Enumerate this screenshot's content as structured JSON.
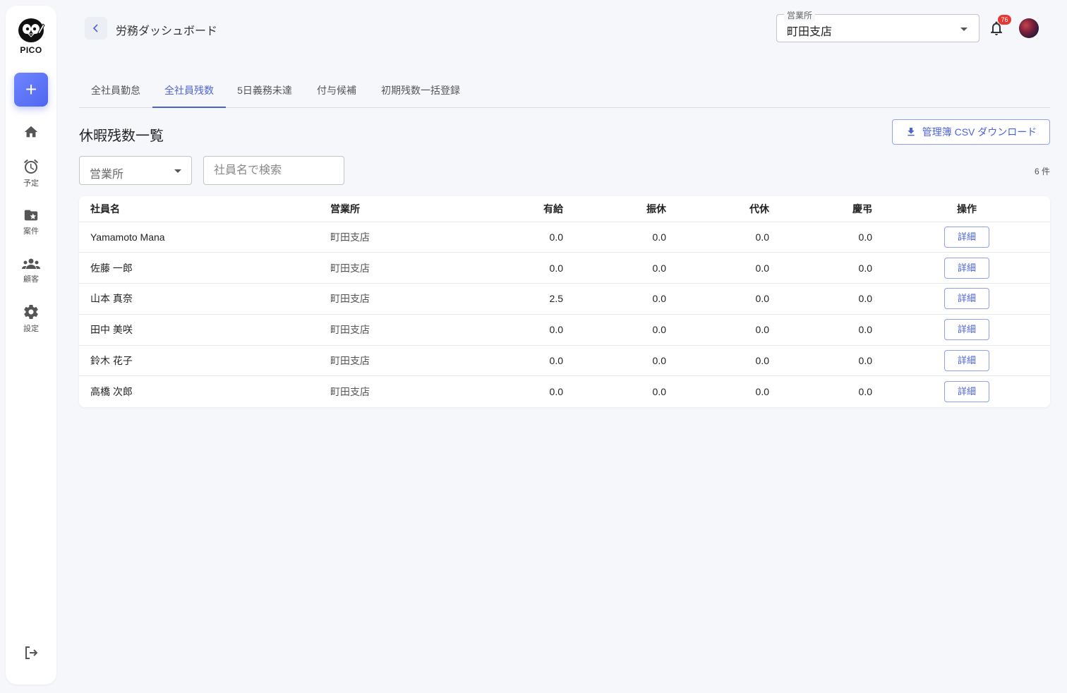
{
  "app": {
    "logo_text": "PICO",
    "accent_color": "#4c63d8"
  },
  "sidebar": {
    "add_button_label": "+",
    "items": [
      {
        "name": "home",
        "icon": "home-icon",
        "label": ""
      },
      {
        "name": "schedule",
        "icon": "alarm-clock-icon",
        "label": "予定"
      },
      {
        "name": "cases",
        "icon": "folder-star-icon",
        "label": "案件"
      },
      {
        "name": "customers",
        "icon": "people-icon",
        "label": "顧客"
      },
      {
        "name": "settings",
        "icon": "gear-icon",
        "label": "設定"
      }
    ],
    "logout_icon": "logout-icon"
  },
  "header": {
    "title": "労務ダッシュボード",
    "office_select": {
      "legend": "営業所",
      "value": "町田支店"
    },
    "notification_count": "76"
  },
  "tabs": [
    {
      "label": "全社員勤怠",
      "active": false
    },
    {
      "label": "全社員残数",
      "active": true
    },
    {
      "label": "5日義務未達",
      "active": false
    },
    {
      "label": "付与候補",
      "active": false
    },
    {
      "label": "初期残数一括登録",
      "active": false
    }
  ],
  "section": {
    "title": "休暇残数一覧",
    "csv_button_label": "管理簿 CSV ダウンロード",
    "filter_office_placeholder": "営業所",
    "search_placeholder": "社員名で検索",
    "count_text": "6 件"
  },
  "table": {
    "headers": {
      "name": "社員名",
      "office": "営業所",
      "paid": "有給",
      "substitute": "振休",
      "compensatory": "代休",
      "bereavement": "慶弔",
      "actions": "操作"
    },
    "detail_label": "詳細",
    "rows": [
      {
        "name": "Yamamoto Mana",
        "office": "町田支店",
        "paid": "0.0",
        "substitute": "0.0",
        "compensatory": "0.0",
        "bereavement": "0.0"
      },
      {
        "name": "佐藤 一郎",
        "office": "町田支店",
        "paid": "0.0",
        "substitute": "0.0",
        "compensatory": "0.0",
        "bereavement": "0.0"
      },
      {
        "name": "山本 真奈",
        "office": "町田支店",
        "paid": "2.5",
        "substitute": "0.0",
        "compensatory": "0.0",
        "bereavement": "0.0"
      },
      {
        "name": "田中 美咲",
        "office": "町田支店",
        "paid": "0.0",
        "substitute": "0.0",
        "compensatory": "0.0",
        "bereavement": "0.0"
      },
      {
        "name": "鈴木 花子",
        "office": "町田支店",
        "paid": "0.0",
        "substitute": "0.0",
        "compensatory": "0.0",
        "bereavement": "0.0"
      },
      {
        "name": "高橋 次郎",
        "office": "町田支店",
        "paid": "0.0",
        "substitute": "0.0",
        "compensatory": "0.0",
        "bereavement": "0.0"
      }
    ]
  }
}
